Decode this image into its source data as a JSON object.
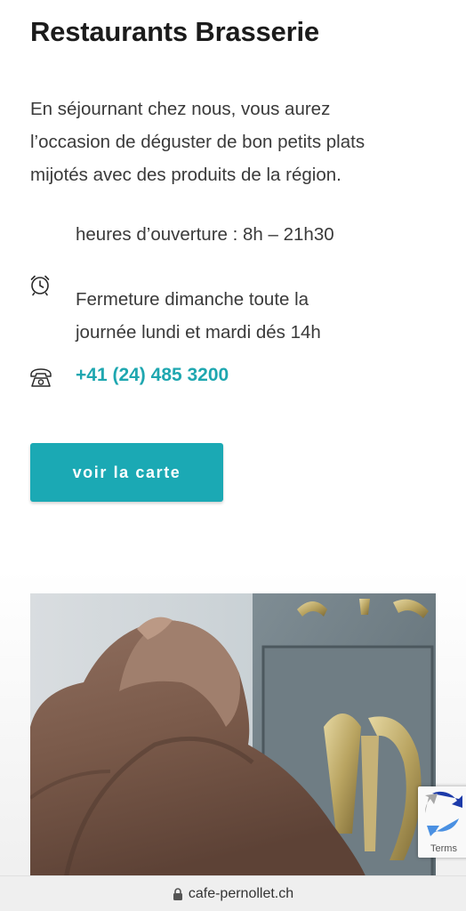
{
  "section": {
    "title": "Restaurants Brasserie",
    "intro_lines": [
      "En séjournant chez nous, vous aurez",
      "l’occasion de déguster de bon petits plats",
      "mijotés avec des produits de la région."
    ]
  },
  "hours": {
    "icon": "alarm-clock-icon",
    "opening": "heures d’ouverture : 8h – 21h30",
    "closing_lines": [
      "Fermeture dimanche toute la",
      "journée lundi et mardi dés 14h"
    ]
  },
  "contact": {
    "icon": "telephone-icon",
    "phone": "+41 (24) 485 3200"
  },
  "cta": {
    "label": "voir la carte"
  },
  "recaptcha": {
    "label": "Terms"
  },
  "browser": {
    "url": "cafe-pernollet.ch",
    "icon": "lock-icon"
  },
  "colors": {
    "accent": "#1ba9b4",
    "text": "#3a3a3a",
    "heading": "#1b1b1b"
  }
}
